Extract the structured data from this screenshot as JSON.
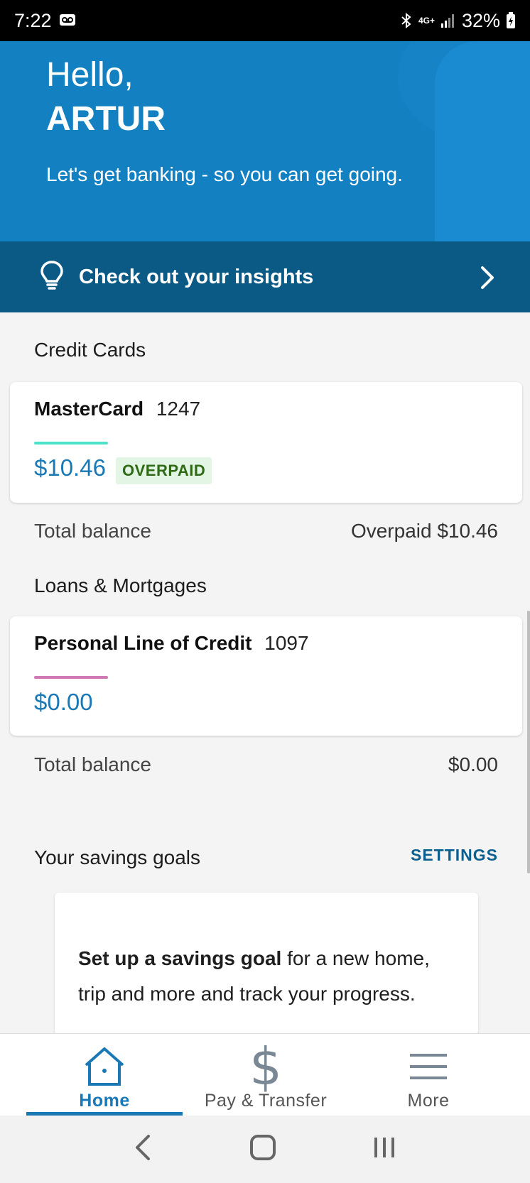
{
  "status_bar": {
    "time": "7:22",
    "battery": "32%",
    "network": "4G+"
  },
  "hero": {
    "greeting": "Hello,",
    "name": "ARTUR",
    "tagline": "Let's get banking - so you can get going."
  },
  "insights": {
    "label": "Check out your insights"
  },
  "credit_cards": {
    "section_title": "Credit Cards",
    "card": {
      "name": "MasterCard",
      "number": "1247",
      "amount": "$10.46",
      "badge": "OVERPAID",
      "accent": "#4de3c8"
    },
    "total_label": "Total balance",
    "total_value": "Overpaid $10.46"
  },
  "loans": {
    "section_title": "Loans & Mortgages",
    "card": {
      "name": "Personal Line of Credit",
      "number": "1097",
      "amount": "$0.00",
      "accent": "#d07ab5"
    },
    "total_label": "Total balance",
    "total_value": "$0.00"
  },
  "savings": {
    "section_title": "Your savings goals",
    "settings_label": "SETTINGS",
    "goal_bold": "Set up a savings goal",
    "goal_rest": " for a new home, trip and more and track your progress."
  },
  "bottom_nav": {
    "items": [
      {
        "label": "Home",
        "icon": "home-icon",
        "active": true
      },
      {
        "label": "Pay & Transfer",
        "icon": "dollar-icon",
        "active": false
      },
      {
        "label": "More",
        "icon": "menu-icon",
        "active": false
      }
    ]
  },
  "colors": {
    "brand_blue": "#1380c2",
    "insights_bar": "#0b5a85",
    "link_blue": "#1a78b4"
  }
}
